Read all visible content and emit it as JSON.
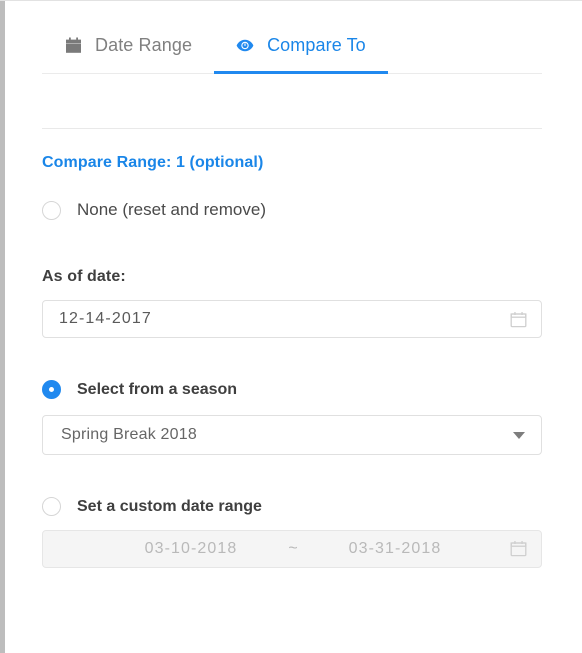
{
  "tabs": [
    {
      "label": "Date Range",
      "icon": "calendar-icon",
      "active": false
    },
    {
      "label": "Compare To",
      "icon": "eye-icon",
      "active": true
    }
  ],
  "compare_section": {
    "title": "Compare Range: 1 (optional)",
    "none_option": "None (reset and remove)",
    "as_of_date_label": "As of date:",
    "as_of_date_value": "12-14-2017",
    "season_option": "Select from a season",
    "season_selected": "Spring Break 2018",
    "custom_option": "Set a custom date range",
    "custom_start": "03-10-2018",
    "custom_separator": "~",
    "custom_end": "03-31-2018"
  },
  "colors": {
    "accent": "#2089ef",
    "accent_text": "#1a86e8",
    "muted_text": "#808080",
    "body_text": "#4a4a4a",
    "disabled_text": "#b9b9b9",
    "disabled_bg": "#f5f5f5",
    "border": "#e0e0e0"
  }
}
